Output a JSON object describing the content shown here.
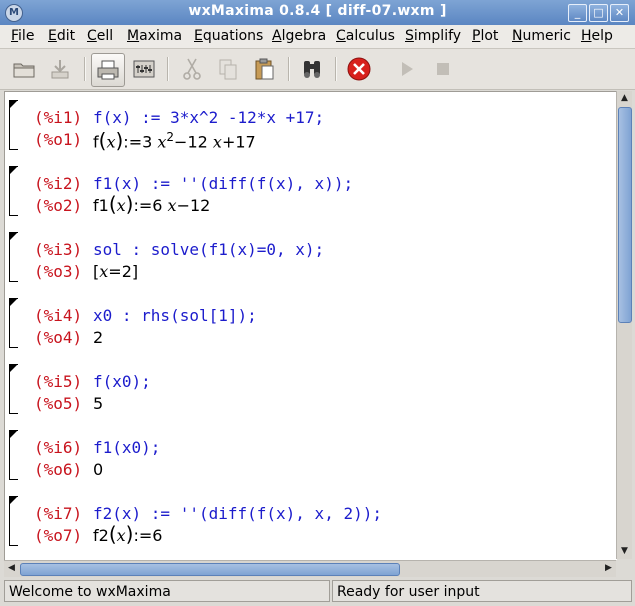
{
  "window": {
    "title": "wxMaxima 0.8.4  [ diff-07.wxm ]",
    "app_icon_glyph": "M",
    "controls": [
      "_",
      "□",
      "✕"
    ]
  },
  "menu": [
    {
      "label": "File"
    },
    {
      "label": "Edit"
    },
    {
      "label": "Cell"
    },
    {
      "label": "Maxima"
    },
    {
      "label": "Equations"
    },
    {
      "label": "Algebra"
    },
    {
      "label": "Calculus"
    },
    {
      "label": "Simplify"
    },
    {
      "label": "Plot"
    },
    {
      "label": "Numeric"
    },
    {
      "label": "Help"
    }
  ],
  "toolbar": {
    "icons": [
      "open-folder-icon",
      "save-icon",
      "print-icon",
      "config-icon",
      "cut-icon",
      "copy-icon",
      "paste-icon",
      "find-icon",
      "interrupt-icon",
      "continue-icon",
      "stop-icon"
    ]
  },
  "cells": [
    {
      "in_label": "(%i1)",
      "in_code": "f(x) := 3*x^2 -12*x +17;",
      "out_label": "(%o1)",
      "out_prefix": "f",
      "out_rest": "3",
      "out_x2": "x",
      "out_sup": "2",
      "out_mid": "−12 ",
      "out_x": "x",
      "out_tail": "+17"
    },
    {
      "in_label": "(%i2)",
      "in_code": "f1(x) := ''(diff(f(x), x));",
      "out_label": "(%o2)",
      "out_prefix": "f1",
      "out_rest": "6 ",
      "out_x": "x",
      "out_tail": "−12"
    },
    {
      "in_label": "(%i3)",
      "in_code": "sol : solve(f1(x)=0, x);",
      "out_label": "(%o3)",
      "out_open": "[",
      "out_x": "x",
      "out_tail": "=2",
      "out_close": "]"
    },
    {
      "in_label": "(%i4)",
      "in_code": "x0 : rhs(sol[1]);",
      "out_label": "(%o4)",
      "out_value": "2"
    },
    {
      "in_label": "(%i5)",
      "in_code": "f(x0);",
      "out_label": "(%o5)",
      "out_value": "5"
    },
    {
      "in_label": "(%i6)",
      "in_code": "f1(x0);",
      "out_label": "(%o6)",
      "out_value": "0"
    },
    {
      "in_label": "(%i7)",
      "in_code": "f2(x) := ''(diff(f(x), x, 2));",
      "out_label": "(%o7)",
      "out_prefix": "f2",
      "out_rest": "6"
    }
  ],
  "status": {
    "left": "Welcome to wxMaxima",
    "right": "Ready for user input"
  },
  "colors": {
    "input_label": "#c8141e",
    "input_code": "#1c1ccc",
    "title_bar": "#5b86c2"
  }
}
